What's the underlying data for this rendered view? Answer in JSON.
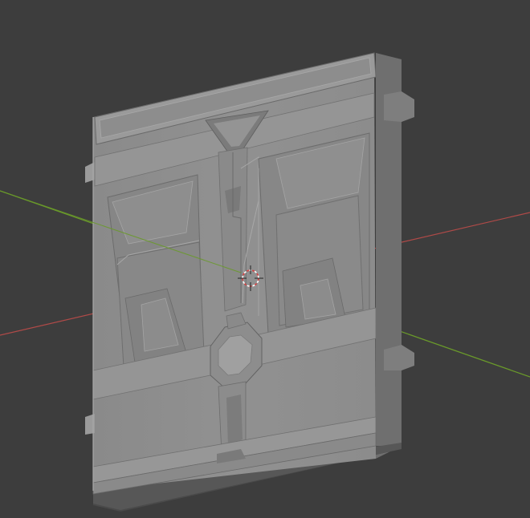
{
  "viewport": {
    "background": "#3d3d3d",
    "x_axis_color": "#c0504d",
    "y_axis_color": "#6a9a2a",
    "cursor_color": "#d44040"
  },
  "object": {
    "kind": "sci-fi door panel mesh",
    "shading": "solid",
    "base_color": "#8e8e8e"
  }
}
